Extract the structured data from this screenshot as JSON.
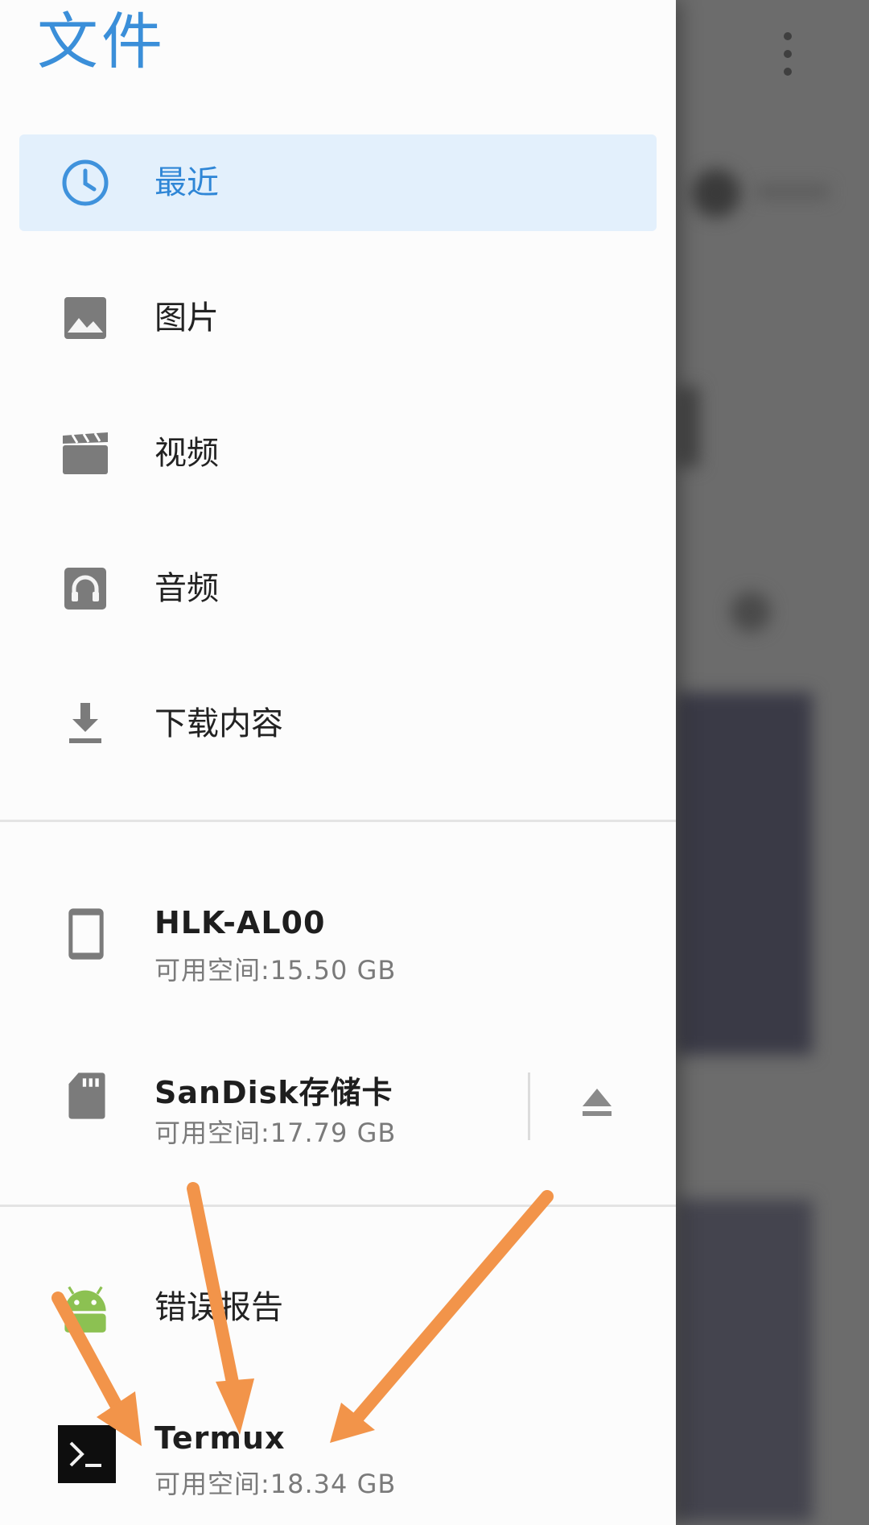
{
  "drawer": {
    "title": "文件",
    "nav": [
      {
        "label": "最近",
        "icon": "clock-icon",
        "active": true
      },
      {
        "label": "图片",
        "icon": "image-icon",
        "active": false
      },
      {
        "label": "视频",
        "icon": "movie-icon",
        "active": false
      },
      {
        "label": "音频",
        "icon": "headphones-icon",
        "active": false
      },
      {
        "label": "下载内容",
        "icon": "download-icon",
        "active": false
      }
    ],
    "storage": [
      {
        "title": "HLK-AL00",
        "subtitle": "可用空间:15.50 GB",
        "icon": "phone-icon"
      },
      {
        "title": "SanDisk存储卡",
        "subtitle": "可用空间:17.79 GB",
        "icon": "sd-card-icon",
        "eject_icon": "eject-icon"
      }
    ],
    "apps": [
      {
        "label": "错误报告",
        "icon": "android-icon"
      },
      {
        "title": "Termux",
        "subtitle": "可用空间:18.34 GB",
        "icon": "terminal-icon"
      }
    ]
  },
  "colors": {
    "accent": "#2f86d6",
    "active_bg": "#e3f0fc",
    "annotation_arrow": "#f2944a"
  }
}
